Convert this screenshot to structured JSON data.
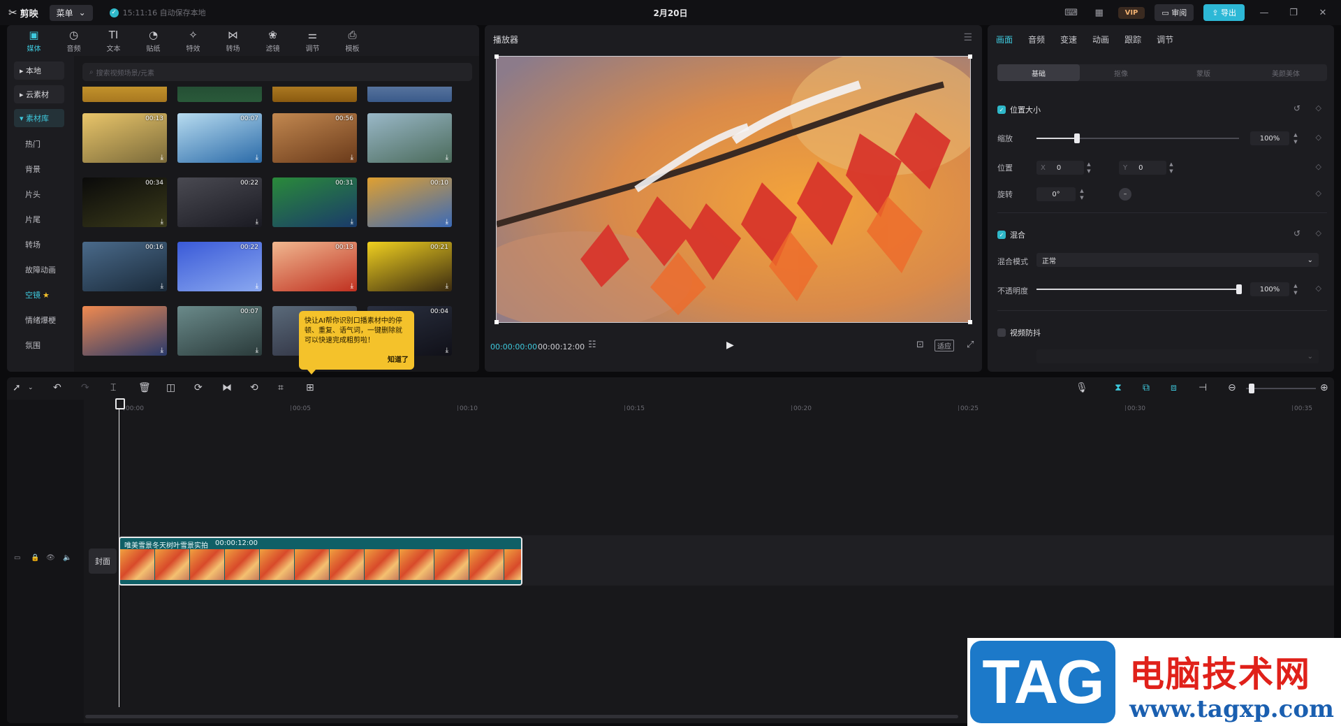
{
  "titlebar": {
    "app_name": "剪映",
    "menu_label": "菜单",
    "autosave_text": "15:11:16 自动保存本地",
    "doc_title": "2月20日",
    "vip_label": "VIP",
    "review_label": "审阅",
    "export_label": "导出",
    "win": {
      "min": "—",
      "max": "❐",
      "close": "✕"
    }
  },
  "media": {
    "tabs": [
      {
        "label": "媒体",
        "glyph": "▣"
      },
      {
        "label": "音频",
        "glyph": "◷"
      },
      {
        "label": "文本",
        "glyph": "TI"
      },
      {
        "label": "贴纸",
        "glyph": "◔"
      },
      {
        "label": "特效",
        "glyph": "✧"
      },
      {
        "label": "转场",
        "glyph": "⋈"
      },
      {
        "label": "滤镜",
        "glyph": "❀"
      },
      {
        "label": "调节",
        "glyph": "⚌"
      },
      {
        "label": "模板",
        "glyph": "⎙"
      }
    ],
    "side_buttons": [
      "本地",
      "云素材",
      "素材库"
    ],
    "side_items": [
      "热门",
      "背景",
      "片头",
      "片尾",
      "转场",
      "故障动画",
      "空镜",
      "情绪爆梗",
      "氛围"
    ],
    "search_placeholder": "搜索视频场景/元素",
    "durations": [
      "00:13",
      "00:07",
      "00:56",
      "",
      "00:34",
      "00:22",
      "00:31",
      "00:10",
      "00:16",
      "00:22",
      "00:13",
      "00:21",
      "",
      "00:07",
      "",
      "00:04"
    ],
    "tooltip": {
      "text": "快让AI帮你识别口播素材中的停顿、重复、语气词，一键删除就可以快速完成粗剪啦！",
      "ok": "知道了"
    }
  },
  "player": {
    "title": "播放器",
    "time_current": "00:00:00:00",
    "time_total": "00:00:12:00",
    "fit_label": "适应"
  },
  "props": {
    "tabs": [
      "画面",
      "音频",
      "变速",
      "动画",
      "跟踪",
      "调节"
    ],
    "subtabs": [
      "基础",
      "抠像",
      "蒙版",
      "美颜美体"
    ],
    "section_position": "位置大小",
    "scale_label": "缩放",
    "scale_value": "100%",
    "scale_level": 0.2,
    "position_label": "位置",
    "x_label": "X",
    "x_value": "0",
    "y_label": "Y",
    "y_value": "0",
    "rotate_label": "旋转",
    "rotate_value": "0°",
    "section_blend": "混合",
    "blend_mode_label": "混合模式",
    "blend_mode_value": "正常",
    "opacity_label": "不透明度",
    "opacity_value": "100%",
    "opacity_level": 1.0,
    "section_stabilize": "视频防抖"
  },
  "timeline": {
    "ruler": [
      "00:00",
      "00:05",
      "00:10",
      "00:15",
      "00:20",
      "00:25",
      "00:30",
      "00:35"
    ],
    "clip_name": "唯美雪景冬天树叶雪景实拍",
    "clip_duration": "00:00:12:00",
    "cover_label": "封面"
  },
  "watermark": {
    "tag": "TAG",
    "cn": "电脑技术网",
    "url": "www.tagxp.com"
  }
}
